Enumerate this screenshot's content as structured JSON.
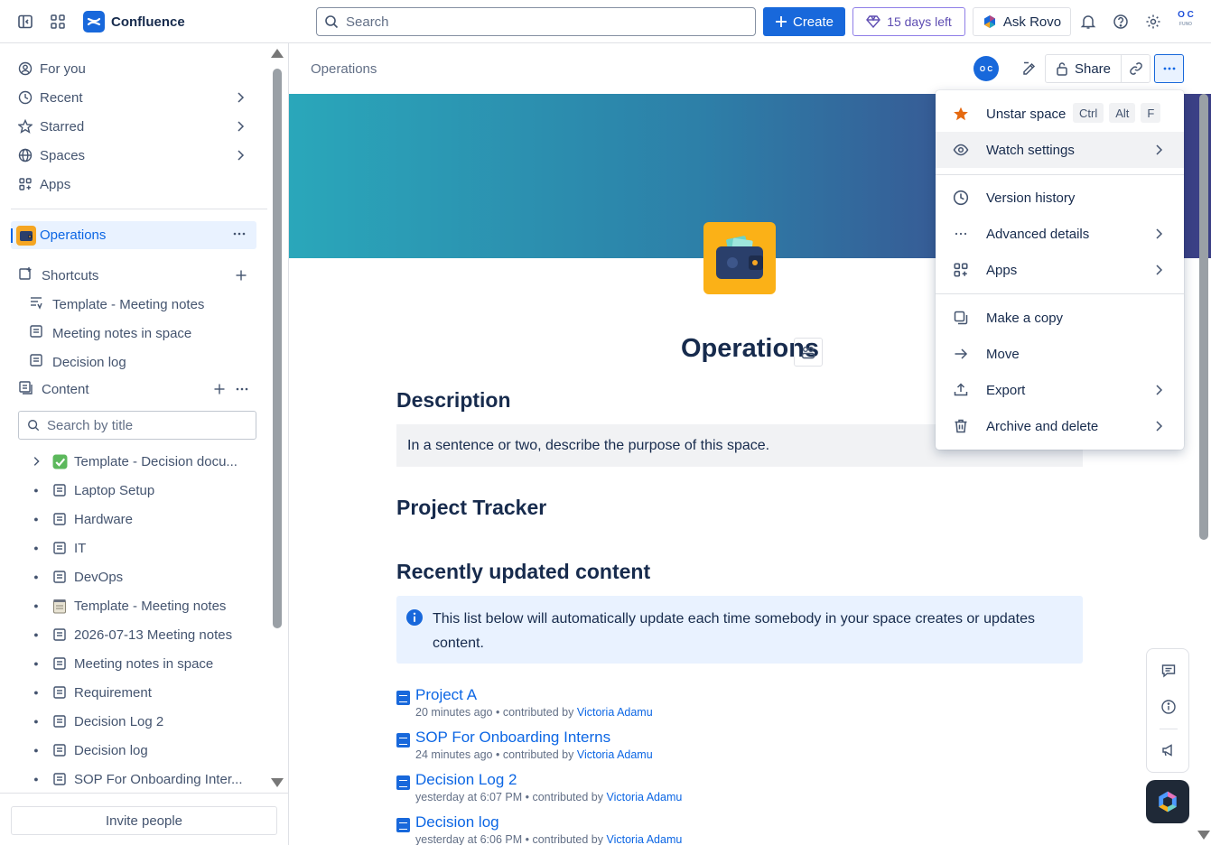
{
  "topbar": {
    "app_name": "Confluence",
    "search_placeholder": "Search",
    "create_label": "Create",
    "trial_label": "15 days left",
    "rovo_label": "Ask Rovo",
    "user_initials_top": "O C",
    "user_initials_bottom": "FUNO"
  },
  "sidebar": {
    "nav": [
      {
        "label": "For you",
        "icon": "user-circle-icon"
      },
      {
        "label": "Recent",
        "icon": "clock-icon"
      },
      {
        "label": "Starred",
        "icon": "star-icon"
      },
      {
        "label": "Spaces",
        "icon": "globe-icon"
      },
      {
        "label": "Apps",
        "icon": "apps-icon"
      }
    ],
    "space_name": "Operations",
    "shortcuts_label": "Shortcuts",
    "shortcuts": [
      {
        "label": "Template - Meeting notes"
      },
      {
        "label": "Meeting notes in space"
      },
      {
        "label": "Decision log"
      }
    ],
    "content_label": "Content",
    "title_search_placeholder": "Search by title",
    "tree": [
      {
        "label": "Template - Decision docu...",
        "icon": "checkbox-emoji",
        "expandable": true
      },
      {
        "label": "Laptop Setup",
        "icon": "page-icon"
      },
      {
        "label": "Hardware",
        "icon": "page-icon"
      },
      {
        "label": "IT",
        "icon": "page-icon"
      },
      {
        "label": "DevOps",
        "icon": "page-icon"
      },
      {
        "label": "Template - Meeting notes",
        "icon": "notepad-emoji"
      },
      {
        "label": "2026-07-13 Meeting notes",
        "icon": "page-icon"
      },
      {
        "label": "Meeting notes in space",
        "icon": "page-icon"
      },
      {
        "label": "Requirement",
        "icon": "page-icon"
      },
      {
        "label": "Decision Log 2",
        "icon": "page-icon"
      },
      {
        "label": "Decision log",
        "icon": "page-icon"
      },
      {
        "label": "SOP For Onboarding Inter...",
        "icon": "page-icon"
      }
    ],
    "invite_label": "Invite people"
  },
  "page": {
    "breadcrumb": "Operations",
    "avatar_initials": "O C",
    "share_label": "Share",
    "title": "Operations",
    "description_heading": "Description",
    "description_text": "In a sentence or two, describe the purpose of this space.",
    "tracker_heading": "Project Tracker",
    "recent_heading": "Recently updated content",
    "info_text": "This list below will automatically update each time somebody in your space creates or updates content.",
    "recent_items": [
      {
        "title": "Project A",
        "time": "20 minutes ago",
        "contrib": "contributed by",
        "author": "Victoria Adamu"
      },
      {
        "title": "SOP For Onboarding Interns",
        "time": "24 minutes ago",
        "contrib": "contributed by",
        "author": "Victoria Adamu"
      },
      {
        "title": "Decision Log 2",
        "time": "yesterday at 6:07 PM",
        "contrib": "contributed by",
        "author": "Victoria Adamu"
      },
      {
        "title": "Decision log",
        "time": "yesterday at 6:06 PM",
        "contrib": "contributed by",
        "author": "Victoria Adamu"
      }
    ]
  },
  "menu": {
    "unstar_label": "Unstar space",
    "unstar_keys": [
      "Ctrl",
      "Alt",
      "F"
    ],
    "watch_label": "Watch settings",
    "version_label": "Version history",
    "advanced_label": "Advanced details",
    "apps_label": "Apps",
    "copy_label": "Make a copy",
    "move_label": "Move",
    "export_label": "Export",
    "archive_label": "Archive and delete"
  },
  "colors": {
    "brand": "#1868db",
    "selected_bg": "#e9f2ff",
    "trial_border": "#8f7ee7",
    "star": "#e56910"
  }
}
